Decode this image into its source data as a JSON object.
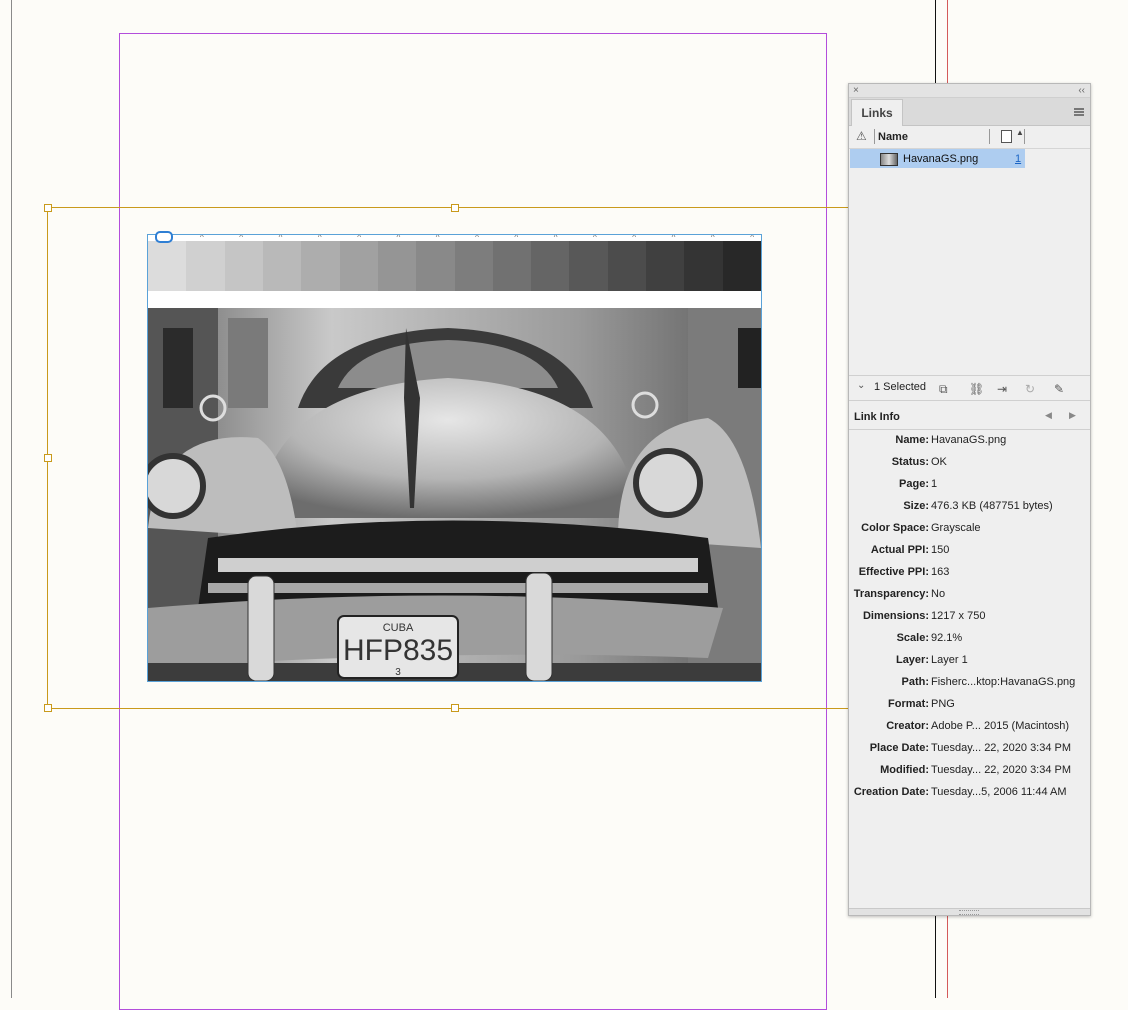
{
  "links_panel": {
    "tab_label": "Links",
    "close_glyph": "×",
    "collapse_glyph": "‹‹",
    "columns": {
      "warning_icon": "warning-icon",
      "name": "Name",
      "page_icon": "page-icon"
    },
    "rows": [
      {
        "name": "HavanaGS.png",
        "page": "1",
        "thumbnail_icon": "image-thumbnail-icon"
      }
    ],
    "toolbar": {
      "selection_count": "1 Selected",
      "icons": [
        "relink-from-cc-icon",
        "relink-icon",
        "goto-link-icon",
        "update-link-icon",
        "edit-original-icon"
      ]
    },
    "link_info": {
      "title": "Link Info",
      "fields": [
        {
          "label": "Name:",
          "value": "HavanaGS.png"
        },
        {
          "label": "Status:",
          "value": "OK"
        },
        {
          "label": "Page:",
          "value": "1"
        },
        {
          "label": "Size:",
          "value": "476.3 KB (487751 bytes)"
        },
        {
          "label": "Color Space:",
          "value": "Grayscale"
        },
        {
          "label": "Actual PPI:",
          "value": "150"
        },
        {
          "label": "Effective PPI:",
          "value": "163"
        },
        {
          "label": "Transparency:",
          "value": "No"
        },
        {
          "label": "Dimensions:",
          "value": "1217 x 750"
        },
        {
          "label": "Scale:",
          "value": "92.1%"
        },
        {
          "label": "Layer:",
          "value": "Layer 1"
        },
        {
          "label": "Path:",
          "value": "Fisherc...ktop:HavanaGS.png"
        },
        {
          "label": "Format:",
          "value": "PNG"
        },
        {
          "label": "Creator:",
          "value": "Adobe P... 2015 (Macintosh)"
        },
        {
          "label": "Place Date:",
          "value": "Tuesday... 22, 2020 3:34 PM"
        },
        {
          "label": "Modified:",
          "value": "Tuesday... 22, 2020 3:34 PM"
        },
        {
          "label": "Creation Date:",
          "value": "Tuesday...5, 2006 11:44 AM"
        }
      ]
    }
  },
  "canvas": {
    "image": {
      "plate_country": "CUBA",
      "plate_number": "HFP835",
      "plate_sub": "3"
    },
    "gray_ramp": [
      "#dcdcdc",
      "#d0d0d0",
      "#c5c5c5",
      "#b9b9b9",
      "#adadad",
      "#a1a1a1",
      "#959595",
      "#898989",
      "#7d7d7d",
      "#717171",
      "#656565",
      "#585858",
      "#4c4c4c",
      "#404040",
      "#343434",
      "#282828"
    ],
    "colors": {
      "margin_guide": "#b34ddb",
      "frame_selection": "#c99a1c",
      "content_frame": "#5aa2d8",
      "selected_row": "#aecdf0"
    }
  }
}
